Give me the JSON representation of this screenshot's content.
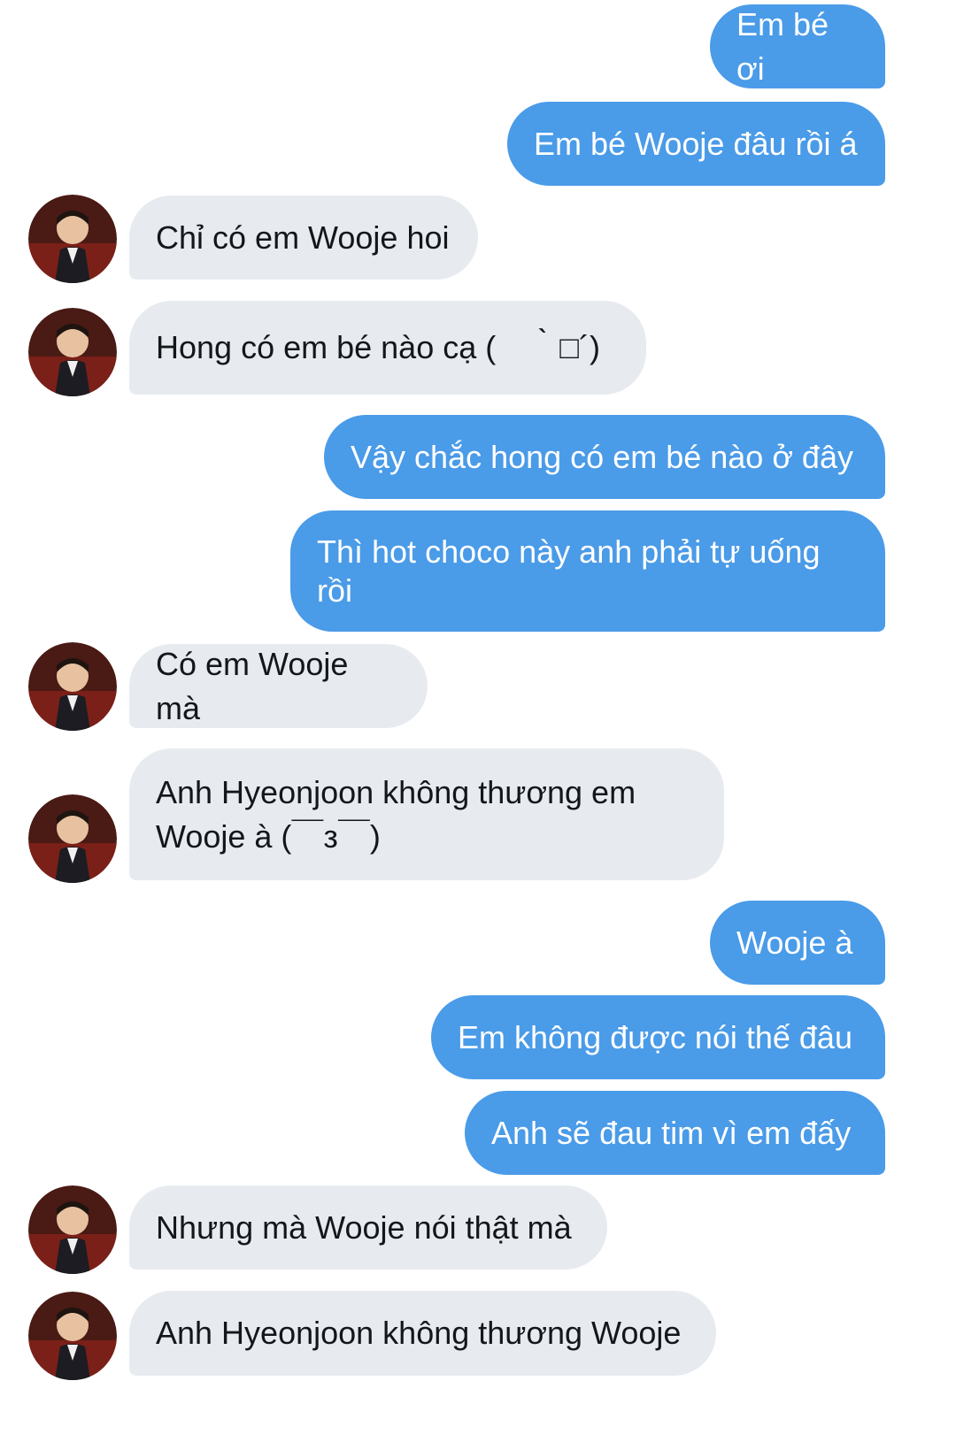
{
  "messages": [
    {
      "from": "me",
      "text": "Em bé ơi"
    },
    {
      "from": "me",
      "text": "Em bé Wooje đâu rồi á"
    },
    {
      "from": "them",
      "text": "Chỉ có em Wooje hoi"
    },
    {
      "from": "them",
      "text": "Hong có em bé nào cạ (　｀□´)"
    },
    {
      "from": "me",
      "text": "Vậy chắc hong có em bé nào ở đây"
    },
    {
      "from": "me",
      "text": "Thì hot choco này anh phải tự uống rồi"
    },
    {
      "from": "them",
      "text": "Có em Wooje mà"
    },
    {
      "from": "them",
      "text": "Anh Hyeonjoon không thương em Wooje à (￣з￣)"
    },
    {
      "from": "me",
      "text": "Wooje à"
    },
    {
      "from": "me",
      "text": "Em không được nói thế đâu"
    },
    {
      "from": "me",
      "text": "Anh sẽ đau tim vì em đấy"
    },
    {
      "from": "them",
      "text": "Nhưng mà Wooje nói thật mà"
    },
    {
      "from": "them",
      "text": "Anh Hyeonjoon không thương Wooje"
    }
  ],
  "colors": {
    "outgoing_bubble": "#4a9be8",
    "incoming_bubble": "#e7ebf0",
    "outgoing_text": "#ffffff",
    "incoming_text": "#14171a"
  },
  "avatar_icon": "contact-photo"
}
